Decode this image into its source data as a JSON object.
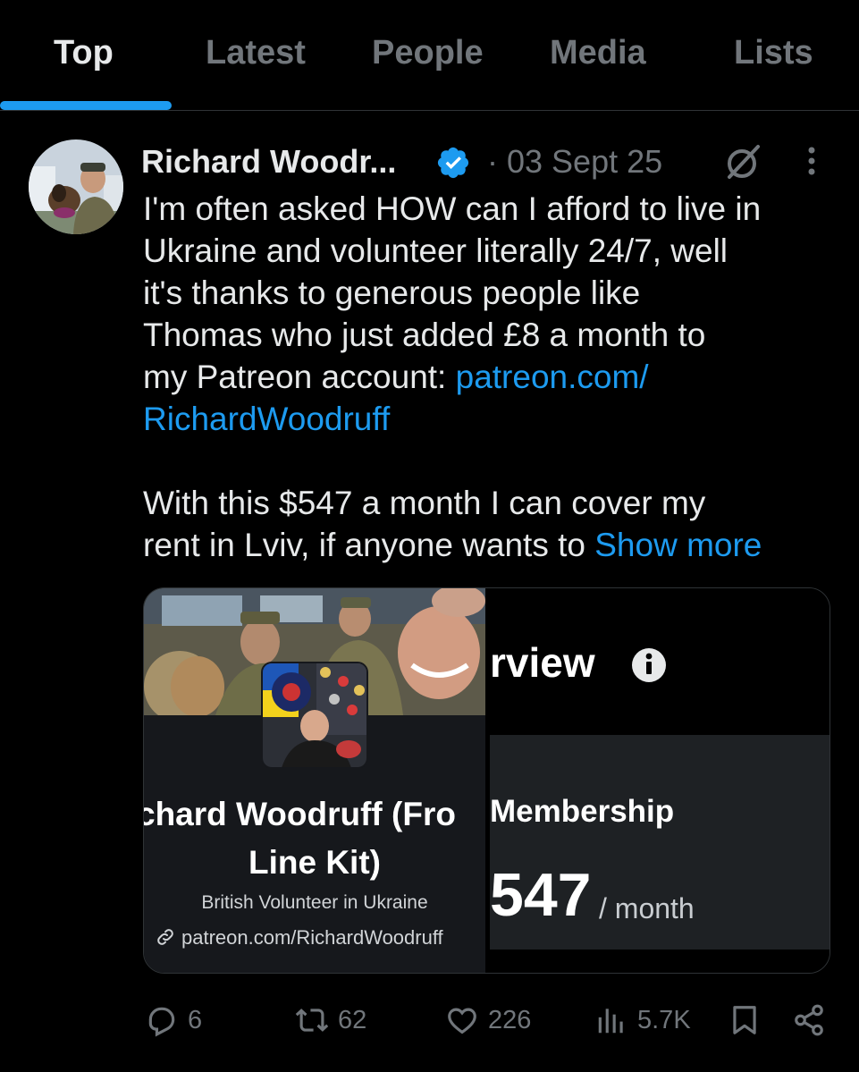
{
  "tabs": [
    {
      "label": "Top",
      "active": true
    },
    {
      "label": "Latest",
      "active": false
    },
    {
      "label": "People",
      "active": false
    },
    {
      "label": "Media",
      "active": false
    },
    {
      "label": "Lists",
      "active": false
    }
  ],
  "tweet": {
    "author_name": "Richard Woodr...",
    "date": "· 03 Sept 25",
    "text_lines": [
      "I'm often asked HOW can I afford to live in",
      "Ukraine and volunteer literally 24/7, well",
      "it's thanks to generous people like",
      "Thomas who just added £8 a month to"
    ],
    "text_line5": "my Patreon account: ",
    "link_part1": "patreon.com/",
    "link_part2": "RichardWoodruff",
    "text_line8": "With this $547 a month I can cover my",
    "text_line9": "rent in Lviv, if anyone wants to ",
    "show_more": "Show more"
  },
  "card": {
    "title_line1": "chard Woodruff (Fro",
    "title_line2": "Line Kit)",
    "subtitle": "British Volunteer in Ukraine",
    "url": "patreon.com/RichardWoodruff",
    "overview": "rview",
    "membership": "Membership",
    "amount": "547",
    "per_month": "/ month"
  },
  "actions": {
    "replies": "6",
    "reposts": "62",
    "likes": "226",
    "views": "5.7K"
  },
  "colors": {
    "accent": "#1d9bf0",
    "muted": "#71767b",
    "text": "#e7e9ea",
    "background": "#000000"
  },
  "icons": [
    "verified-badge-icon",
    "grok-icon",
    "more-icon",
    "info-icon",
    "link-icon",
    "reply-icon",
    "repost-icon",
    "like-icon",
    "views-icon",
    "bookmark-icon",
    "share-icon"
  ]
}
